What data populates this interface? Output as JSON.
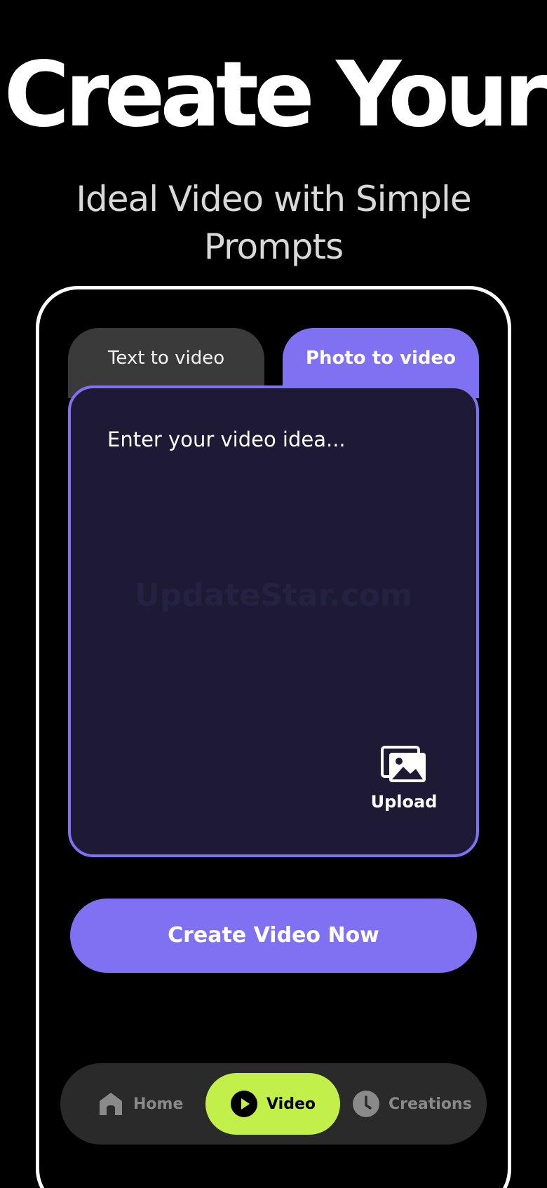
{
  "hero": {
    "title": "Create Your",
    "subtitle": "Ideal Video with Simple Prompts"
  },
  "tabs": [
    {
      "label": "Text to video",
      "active": false
    },
    {
      "label": "Photo to video",
      "active": true
    }
  ],
  "prompt": {
    "placeholder": "Enter your video idea...",
    "watermark": "UpdateStar.com",
    "upload_label": "Upload"
  },
  "cta": {
    "label": "Create Video Now"
  },
  "nav": {
    "items": [
      {
        "label": "Home",
        "icon": "home-icon",
        "active": false
      },
      {
        "label": "Video",
        "icon": "play-icon",
        "active": true
      },
      {
        "label": "Creations",
        "icon": "clock-icon",
        "active": false
      }
    ]
  },
  "colors": {
    "accent": "#8070f2",
    "nav_active": "#c3ef4a",
    "prompt_bg": "#1e1a36",
    "tab_inactive": "#3a3a3a"
  }
}
